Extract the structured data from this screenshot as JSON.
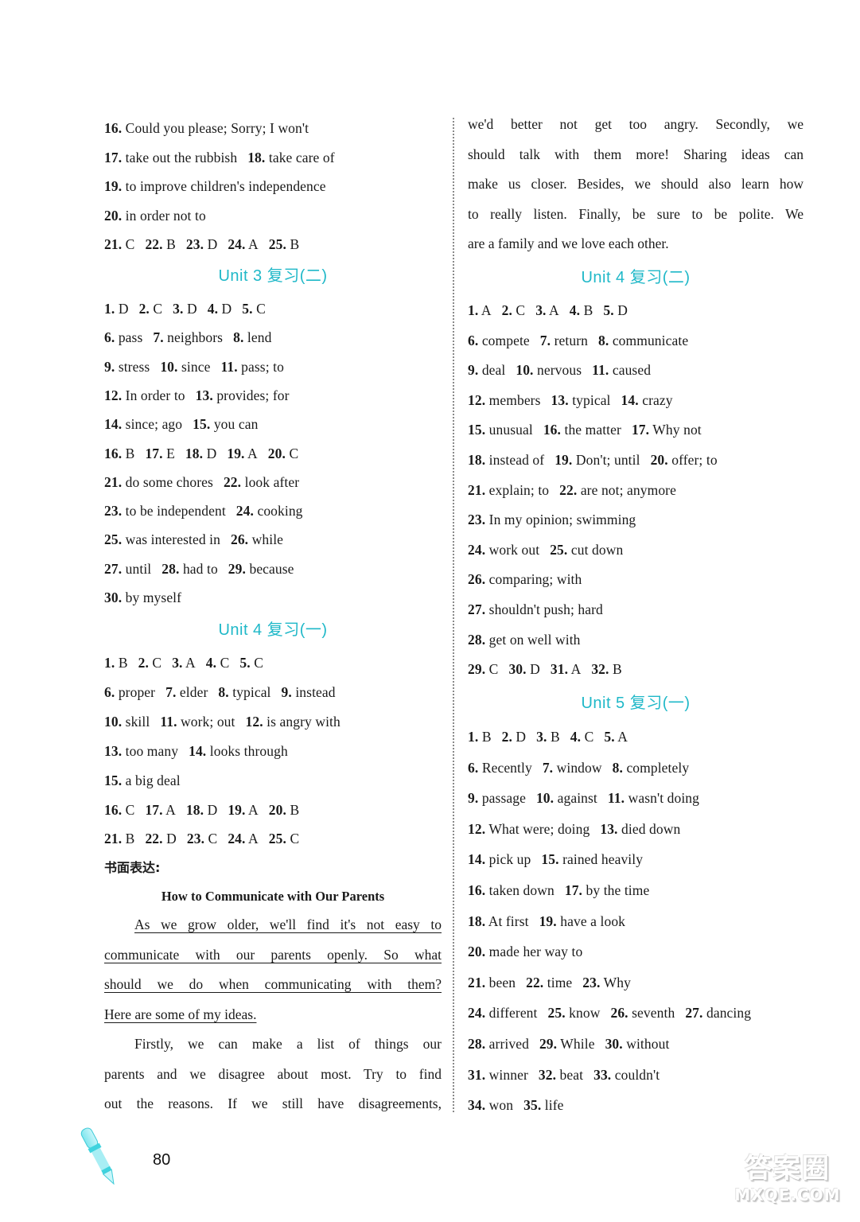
{
  "left_column": {
    "top_answers": [
      [
        {
          "n": "16.",
          "t": "Could you please; Sorry; I won't"
        }
      ],
      [
        {
          "n": "17.",
          "t": "take out the rubbish"
        },
        {
          "n": "18.",
          "t": "take care of"
        }
      ],
      [
        {
          "n": "19.",
          "t": "to improve children's independence"
        }
      ],
      [
        {
          "n": "20.",
          "t": "in order not to"
        }
      ],
      [
        {
          "n": "21.",
          "t": "C"
        },
        {
          "n": "22.",
          "t": "B"
        },
        {
          "n": "23.",
          "t": "D"
        },
        {
          "n": "24.",
          "t": "A"
        },
        {
          "n": "25.",
          "t": "B"
        }
      ]
    ],
    "unit3_review2": {
      "title": "Unit 3 复习(二)",
      "lines": [
        [
          {
            "n": "1.",
            "t": "D"
          },
          {
            "n": "2.",
            "t": "C"
          },
          {
            "n": "3.",
            "t": "D"
          },
          {
            "n": "4.",
            "t": "D"
          },
          {
            "n": "5.",
            "t": "C"
          }
        ],
        [
          {
            "n": "6.",
            "t": "pass"
          },
          {
            "n": "7.",
            "t": "neighbors"
          },
          {
            "n": "8.",
            "t": "lend"
          }
        ],
        [
          {
            "n": "9.",
            "t": "stress"
          },
          {
            "n": "10.",
            "t": "since"
          },
          {
            "n": "11.",
            "t": "pass; to"
          }
        ],
        [
          {
            "n": "12.",
            "t": "In order to"
          },
          {
            "n": "13.",
            "t": "provides; for"
          }
        ],
        [
          {
            "n": "14.",
            "t": "since; ago"
          },
          {
            "n": "15.",
            "t": "you can"
          }
        ],
        [
          {
            "n": "16.",
            "t": "B"
          },
          {
            "n": "17.",
            "t": "E"
          },
          {
            "n": "18.",
            "t": "D"
          },
          {
            "n": "19.",
            "t": "A"
          },
          {
            "n": "20.",
            "t": "C"
          }
        ],
        [
          {
            "n": "21.",
            "t": "do some chores"
          },
          {
            "n": "22.",
            "t": "look after"
          }
        ],
        [
          {
            "n": "23.",
            "t": "to be independent"
          },
          {
            "n": "24.",
            "t": "cooking"
          }
        ],
        [
          {
            "n": "25.",
            "t": "was interested in"
          },
          {
            "n": "26.",
            "t": "while"
          }
        ],
        [
          {
            "n": "27.",
            "t": "until"
          },
          {
            "n": "28.",
            "t": "had to"
          },
          {
            "n": "29.",
            "t": "because"
          }
        ],
        [
          {
            "n": "30.",
            "t": "by myself"
          }
        ]
      ]
    },
    "unit4_review1": {
      "title": "Unit 4 复习(一)",
      "lines": [
        [
          {
            "n": "1.",
            "t": "B"
          },
          {
            "n": "2.",
            "t": "C"
          },
          {
            "n": "3.",
            "t": "A"
          },
          {
            "n": "4.",
            "t": "C"
          },
          {
            "n": "5.",
            "t": "C"
          }
        ],
        [
          {
            "n": "6.",
            "t": "proper"
          },
          {
            "n": "7.",
            "t": "elder"
          },
          {
            "n": "8.",
            "t": "typical"
          },
          {
            "n": "9.",
            "t": "instead"
          }
        ],
        [
          {
            "n": "10.",
            "t": "skill"
          },
          {
            "n": "11.",
            "t": "work; out"
          },
          {
            "n": "12.",
            "t": "is angry with"
          }
        ],
        [
          {
            "n": "13.",
            "t": "too many"
          },
          {
            "n": "14.",
            "t": "looks through"
          }
        ],
        [
          {
            "n": "15.",
            "t": "a big deal"
          }
        ],
        [
          {
            "n": "16.",
            "t": "C"
          },
          {
            "n": "17.",
            "t": "A"
          },
          {
            "n": "18.",
            "t": "D"
          },
          {
            "n": "19.",
            "t": "A"
          },
          {
            "n": "20.",
            "t": "B"
          }
        ],
        [
          {
            "n": "21.",
            "t": "B"
          },
          {
            "n": "22.",
            "t": "D"
          },
          {
            "n": "23.",
            "t": "C"
          },
          {
            "n": "24.",
            "t": "A"
          },
          {
            "n": "25.",
            "t": "C"
          }
        ]
      ],
      "writing_label": "书面表达:",
      "essay_title": "How to Communicate with Our Parents",
      "essay_left_lines": [
        {
          "t": "As we grow older, we'll find it's not easy to",
          "underline": true,
          "indent": true
        },
        {
          "t": "communicate with our parents openly. So what",
          "underline": true
        },
        {
          "t": "should we do when communicating with them?",
          "underline": true
        },
        {
          "t": "Here are some of my ideas.",
          "underline": true,
          "last": true
        },
        {
          "t": "Firstly, we can make a list of things our",
          "indent": true
        },
        {
          "t": "parents and we disagree about most. Try to find"
        },
        {
          "t": "out the reasons. If we still have disagreements,"
        }
      ]
    }
  },
  "right_column": {
    "essay_right_lines": [
      {
        "t": "we'd better not get too angry. Secondly, we"
      },
      {
        "t": "should talk with them more! Sharing ideas can"
      },
      {
        "t": "make us closer. Besides, we should also learn how"
      },
      {
        "t": "to really listen. Finally, be sure to be polite. We"
      },
      {
        "t": "are a family and we love each other.",
        "last": true
      }
    ],
    "unit4_review2": {
      "title": "Unit 4 复习(二)",
      "lines": [
        [
          {
            "n": "1.",
            "t": "A"
          },
          {
            "n": "2.",
            "t": "C"
          },
          {
            "n": "3.",
            "t": "A"
          },
          {
            "n": "4.",
            "t": "B"
          },
          {
            "n": "5.",
            "t": "D"
          }
        ],
        [
          {
            "n": "6.",
            "t": "compete"
          },
          {
            "n": "7.",
            "t": "return"
          },
          {
            "n": "8.",
            "t": "communicate"
          }
        ],
        [
          {
            "n": "9.",
            "t": "deal"
          },
          {
            "n": "10.",
            "t": "nervous"
          },
          {
            "n": "11.",
            "t": "caused"
          }
        ],
        [
          {
            "n": "12.",
            "t": "members"
          },
          {
            "n": "13.",
            "t": "typical"
          },
          {
            "n": "14.",
            "t": "crazy"
          }
        ],
        [
          {
            "n": "15.",
            "t": "unusual"
          },
          {
            "n": "16.",
            "t": "the matter"
          },
          {
            "n": "17.",
            "t": "Why not"
          }
        ],
        [
          {
            "n": "18.",
            "t": "instead of"
          },
          {
            "n": "19.",
            "t": "Don't; until"
          },
          {
            "n": "20.",
            "t": "offer; to"
          }
        ],
        [
          {
            "n": "21.",
            "t": "explain; to"
          },
          {
            "n": "22.",
            "t": "are not; anymore"
          }
        ],
        [
          {
            "n": "23.",
            "t": "In my opinion; swimming"
          }
        ],
        [
          {
            "n": "24.",
            "t": "work out"
          },
          {
            "n": "25.",
            "t": "cut down"
          }
        ],
        [
          {
            "n": "26.",
            "t": "comparing; with"
          }
        ],
        [
          {
            "n": "27.",
            "t": "shouldn't push; hard"
          }
        ],
        [
          {
            "n": "28.",
            "t": "get on well with"
          }
        ],
        [
          {
            "n": "29.",
            "t": "C"
          },
          {
            "n": "30.",
            "t": "D"
          },
          {
            "n": "31.",
            "t": "A"
          },
          {
            "n": "32.",
            "t": "B"
          }
        ]
      ]
    },
    "unit5_review1": {
      "title": "Unit 5 复习(一)",
      "lines": [
        [
          {
            "n": "1.",
            "t": "B"
          },
          {
            "n": "2.",
            "t": "D"
          },
          {
            "n": "3.",
            "t": "B"
          },
          {
            "n": "4.",
            "t": "C"
          },
          {
            "n": "5.",
            "t": "A"
          }
        ],
        [
          {
            "n": "6.",
            "t": "Recently"
          },
          {
            "n": "7.",
            "t": "window"
          },
          {
            "n": "8.",
            "t": "completely"
          }
        ],
        [
          {
            "n": "9.",
            "t": "passage"
          },
          {
            "n": "10.",
            "t": "against"
          },
          {
            "n": "11.",
            "t": "wasn't doing"
          }
        ],
        [
          {
            "n": "12.",
            "t": "What were; doing"
          },
          {
            "n": "13.",
            "t": "died down"
          }
        ],
        [
          {
            "n": "14.",
            "t": "pick up"
          },
          {
            "n": "15.",
            "t": "rained heavily"
          }
        ],
        [
          {
            "n": "16.",
            "t": "taken down"
          },
          {
            "n": "17.",
            "t": "by the time"
          }
        ],
        [
          {
            "n": "18.",
            "t": "At first"
          },
          {
            "n": "19.",
            "t": "have a look"
          }
        ],
        [
          {
            "n": "20.",
            "t": "made her way to"
          }
        ],
        [
          {
            "n": "21.",
            "t": "been"
          },
          {
            "n": "22.",
            "t": "time"
          },
          {
            "n": "23.",
            "t": "Why"
          }
        ],
        [
          {
            "n": "24.",
            "t": "different"
          },
          {
            "n": "25.",
            "t": "know"
          },
          {
            "n": "26.",
            "t": "seventh"
          },
          {
            "n": "27.",
            "t": "dancing"
          }
        ],
        [
          {
            "n": "28.",
            "t": "arrived"
          },
          {
            "n": "29.",
            "t": "While"
          },
          {
            "n": "30.",
            "t": "without"
          }
        ],
        [
          {
            "n": "31.",
            "t": "winner"
          },
          {
            "n": "32.",
            "t": "beat"
          },
          {
            "n": "33.",
            "t": "couldn't"
          }
        ],
        [
          {
            "n": "34.",
            "t": "won"
          },
          {
            "n": "35.",
            "t": "life"
          }
        ]
      ]
    }
  },
  "footer": {
    "page_number": "80",
    "watermark_zh": "答案圈",
    "watermark_en": "MXQE.COM",
    "accent_color": "#1fb8c8"
  }
}
